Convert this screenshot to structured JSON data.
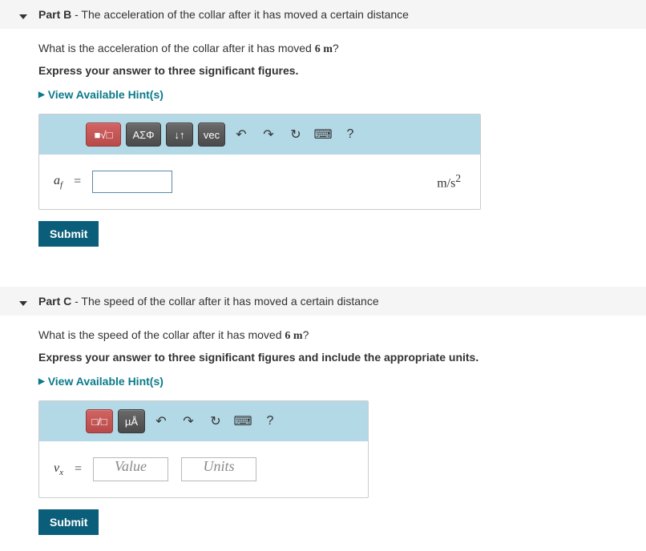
{
  "partB": {
    "label": "Part B",
    "subtitle": " - The acceleration of the collar after it has moved a certain distance",
    "question_pre": "What is the acceleration of the collar after it has moved ",
    "question_val": "6 m",
    "question_post": "?",
    "instruct": "Express your answer to three significant figures.",
    "hints": "View Available Hint(s)",
    "var": "a",
    "var_sub": "f",
    "equals": "=",
    "units": "m/s",
    "units_sup": "2",
    "toolbar": {
      "tpl": "■√□",
      "greek": "ΑΣΦ",
      "subsup": "↓↑",
      "vec": "vec",
      "help": "?"
    },
    "submit": "Submit"
  },
  "partC": {
    "label": "Part C",
    "subtitle": " - The speed of the collar after it has moved a certain distance",
    "question_pre": "What is the speed of the collar after it has moved ",
    "question_val": "6 m",
    "question_post": "?",
    "instruct": "Express your answer to three significant figures and include the appropriate units.",
    "hints": "View Available Hint(s)",
    "var": "v",
    "var_sub": "x",
    "equals": "=",
    "value_placeholder": "Value",
    "units_placeholder": "Units",
    "toolbar": {
      "tpl": "□/□",
      "units": "µÅ",
      "help": "?"
    },
    "submit": "Submit"
  }
}
